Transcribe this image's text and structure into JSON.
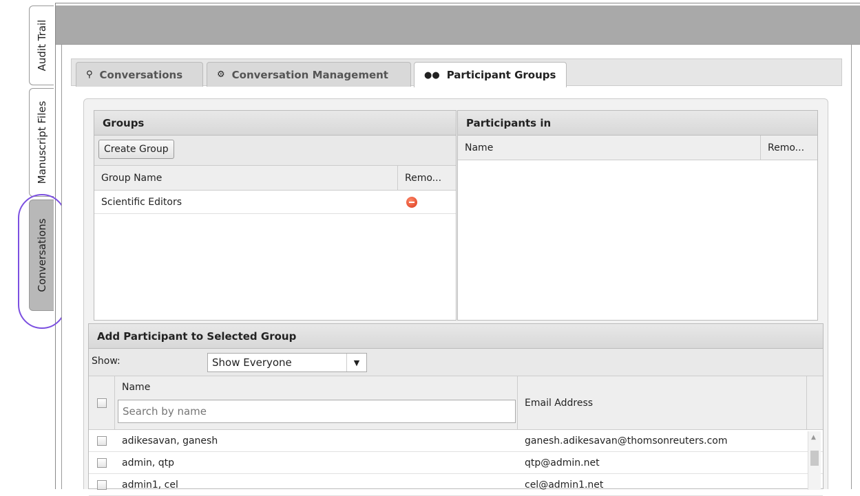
{
  "side_tabs": [
    {
      "label": "Audit Trail"
    },
    {
      "label": "Manuscript Files"
    },
    {
      "label": "Conversations"
    }
  ],
  "tabs": [
    {
      "label": "Conversations",
      "icon": "comments-icon"
    },
    {
      "label": "Conversation Management",
      "icon": "gears-icon"
    },
    {
      "label": "Participant Groups",
      "icon": "users-icon",
      "active": true
    }
  ],
  "groups": {
    "title": "Groups",
    "create_button": "Create Group",
    "columns": [
      "Group Name",
      "Remo..."
    ],
    "rows": [
      {
        "name": "Scientific Editors",
        "remove_icon": "remove-icon"
      }
    ]
  },
  "participants": {
    "title": "Participants in",
    "columns": [
      "Name",
      "Remo..."
    ]
  },
  "add_participant": {
    "title": "Add Participant to Selected Group",
    "show_label": "Show:",
    "show_value": "Show Everyone",
    "columns": {
      "name": "Name",
      "email": "Email Address"
    },
    "search_placeholder": "Search by name",
    "rows": [
      {
        "name": "adikesavan, ganesh",
        "email": "ganesh.adikesavan@thomsonreuters.com"
      },
      {
        "name": "admin, qtp",
        "email": "qtp@admin.net"
      },
      {
        "name": "admin1, cel",
        "email": "cel@admin1.net"
      }
    ]
  },
  "colors": {
    "highlight_ring": "#7b4fe0",
    "topbar": "#a9a9a9",
    "remove": "#d9361a"
  }
}
